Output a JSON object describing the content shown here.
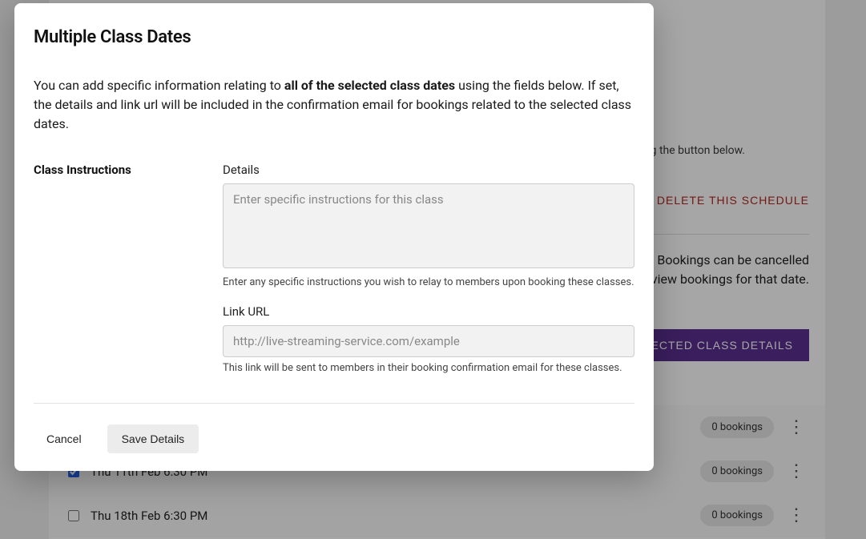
{
  "modal": {
    "title": "Multiple Class Dates",
    "intro_before": "You can add specific information relating to ",
    "intro_bold": "all of the selected class dates",
    "intro_after": " using the fields below. If set, the details and link url will be included in the confirmation email for bookings related to the selected class dates.",
    "section_label": "Class Instructions",
    "details_label": "Details",
    "details_placeholder": "Enter specific instructions for this class",
    "details_help": "Enter any specific instructions you wish to relay to members upon booking these classes.",
    "link_label": "Link URL",
    "link_placeholder": "http://live-streaming-service.com/example",
    "link_help": "This link will be sent to members in their booking confirmation email for these classes.",
    "cancel": "Cancel",
    "save": "Save Details"
  },
  "background": {
    "notice_suffix": "e events using the button below.",
    "delete_schedule": "DELETE THIS SCHEDULE",
    "desc_line1_suffix": "ted. Bookings can be cancelled",
    "desc_line2_suffix": " view bookings for that date.",
    "update_button_suffix": "TE SELECTED CLASS DETAILS",
    "dates": [
      {
        "checked": true,
        "label": "",
        "bookings": "0 bookings"
      },
      {
        "checked": true,
        "label": "Thu 11th Feb 6:30 PM",
        "bookings": "0 bookings"
      },
      {
        "checked": false,
        "label": "Thu 18th Feb 6:30 PM",
        "bookings": "0 bookings"
      }
    ]
  }
}
